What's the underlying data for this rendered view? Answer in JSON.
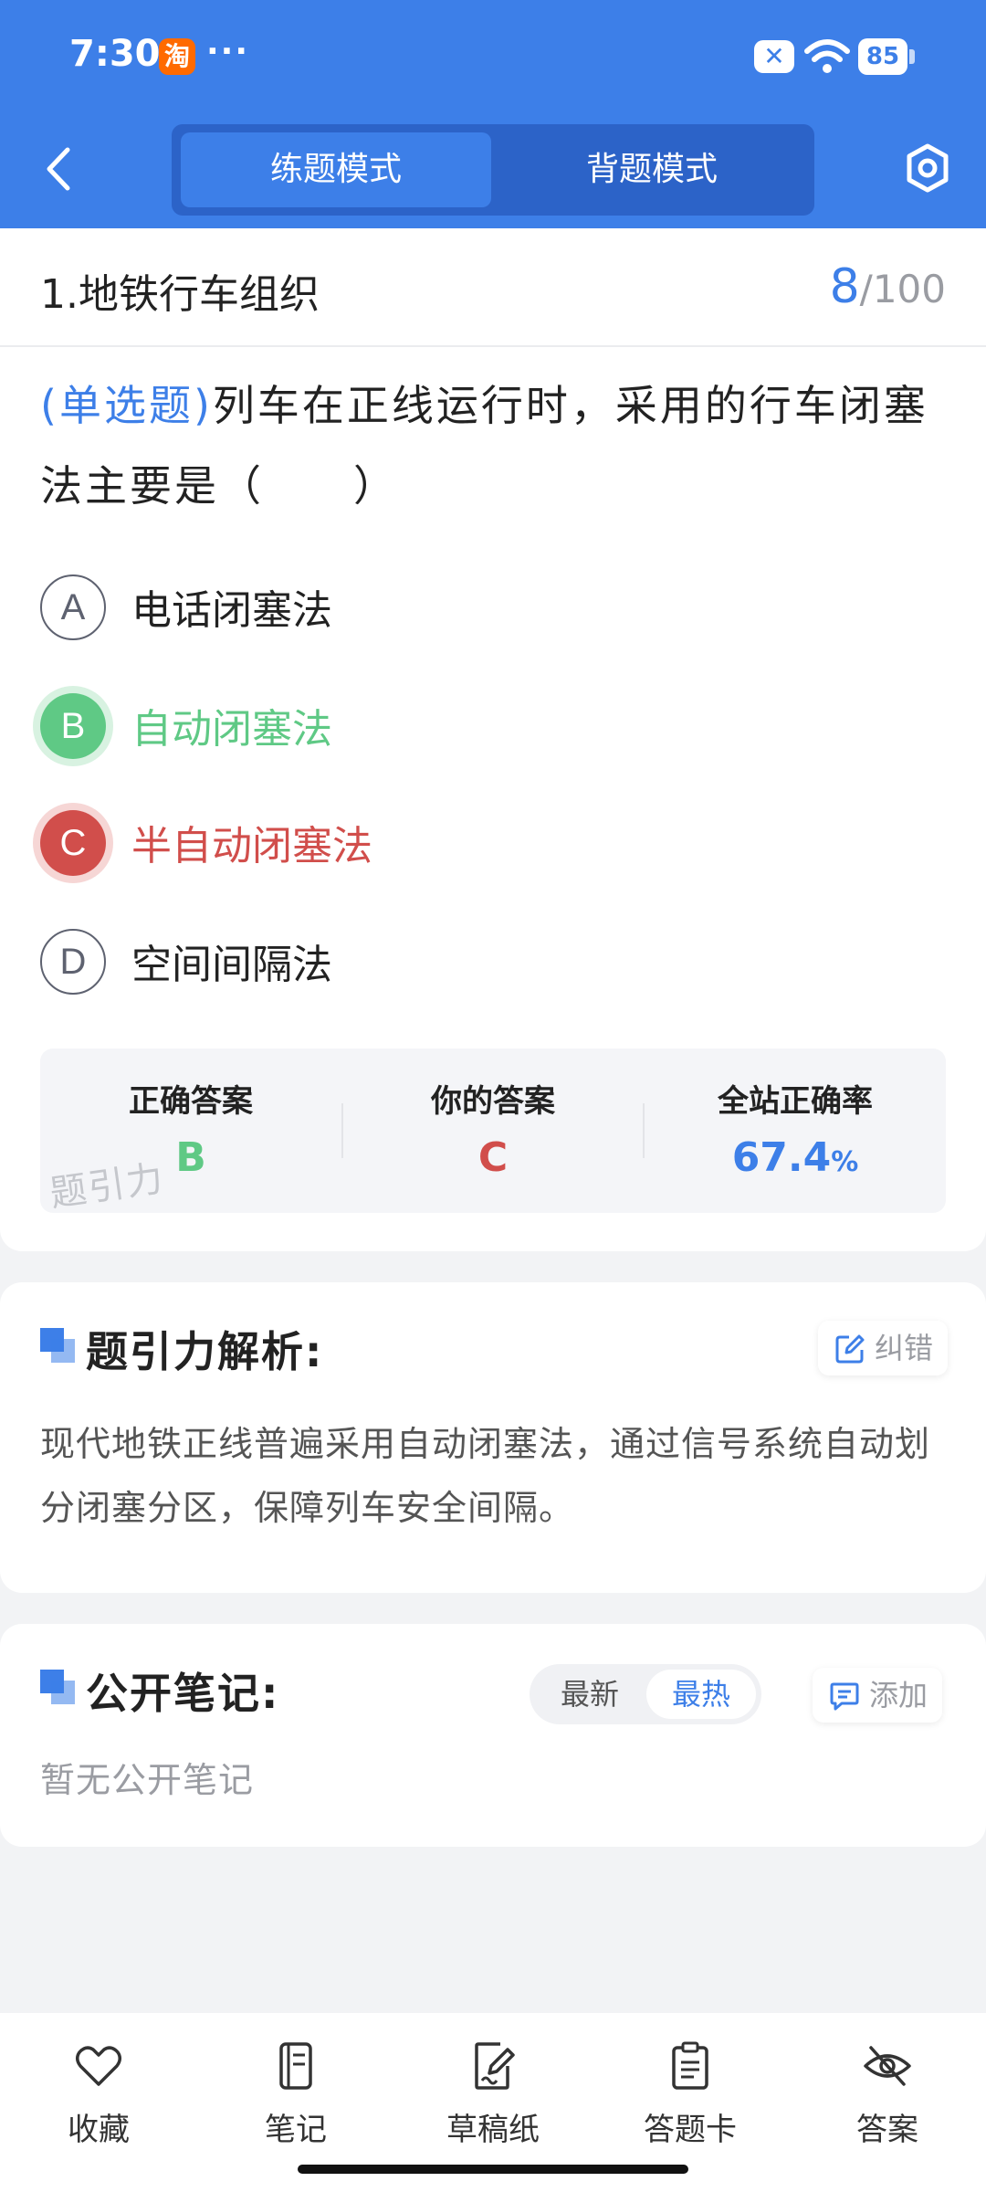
{
  "status_bar": {
    "time": "7:30",
    "app_badge": "淘",
    "dots": "···",
    "battery": "85"
  },
  "header": {
    "tabs": [
      {
        "label": "练题模式",
        "active": true
      },
      {
        "label": "背题模式",
        "active": false
      }
    ]
  },
  "chapter": {
    "title": "1.地铁行车组织",
    "current": "8",
    "total": "/100"
  },
  "question": {
    "type": "(单选题)",
    "text": "列车在正线运行时，采用的行车闭塞法主要是（　　）",
    "options": [
      {
        "letter": "A",
        "text": "电话闭塞法",
        "state": "normal"
      },
      {
        "letter": "B",
        "text": "自动闭塞法",
        "state": "correct"
      },
      {
        "letter": "C",
        "text": "半自动闭塞法",
        "state": "wrong"
      },
      {
        "letter": "D",
        "text": "空间间隔法",
        "state": "normal"
      }
    ]
  },
  "answer_summary": {
    "correct_label": "正确答案",
    "correct_value": "B",
    "mine_label": "你的答案",
    "mine_value": "C",
    "rate_label": "全站正确率",
    "rate_value": "67.4",
    "rate_unit": "%",
    "watermark": "题引力"
  },
  "analysis": {
    "title": "题引力解析:",
    "report_label": "纠错",
    "text": "现代地铁正线普遍采用自动闭塞法，通过信号系统自动划分闭塞分区，保障列车安全间隔。"
  },
  "notes": {
    "title": "公开笔记:",
    "sort_options": [
      "最新",
      "最热"
    ],
    "sort_selected": "最热",
    "add_label": "添加",
    "empty_text": "暂无公开笔记"
  },
  "bottom_nav": [
    {
      "label": "收藏",
      "icon": "heart-icon"
    },
    {
      "label": "笔记",
      "icon": "notebook-icon"
    },
    {
      "label": "草稿纸",
      "icon": "draft-paper-icon"
    },
    {
      "label": "答题卡",
      "icon": "answer-card-icon"
    },
    {
      "label": "答案",
      "icon": "eye-off-icon"
    }
  ],
  "colors": {
    "primary": "#3d7fe8",
    "correct": "#5fc985",
    "wrong": "#d14e4b"
  }
}
